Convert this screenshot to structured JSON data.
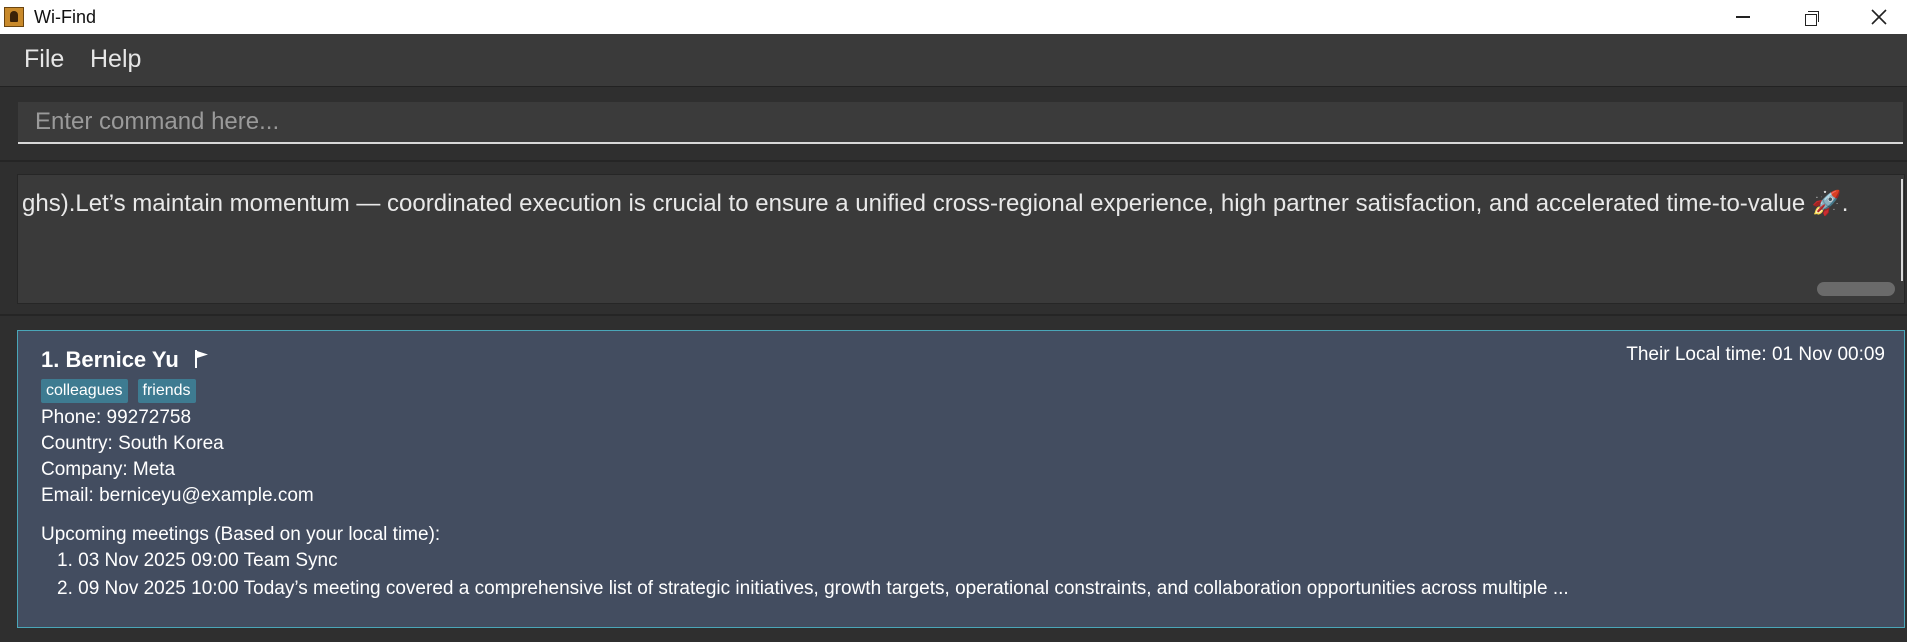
{
  "window": {
    "title": "Wi-Find"
  },
  "menu": {
    "items": [
      "File",
      "Help"
    ]
  },
  "command": {
    "placeholder": "Enter command here...",
    "value": ""
  },
  "result": {
    "text": "ghs).Let’s maintain momentum — coordinated execution is crucial to ensure a unified cross-regional experience, high partner satisfaction, and accelerated time-to-value 🚀."
  },
  "person": {
    "index_name": "1. Bernice Yu",
    "local_time": "Their Local time: 01 Nov 00:09",
    "tags": [
      "colleagues",
      "friends"
    ],
    "phone": "Phone: 99272758",
    "country": "Country: South Korea",
    "company": "Company: Meta",
    "email": "Email: berniceyu@example.com",
    "meetings_label": "Upcoming meetings (Based on your local time):",
    "meetings": [
      "1. 03 Nov 2025 09:00 Team Sync",
      "2. 09 Nov 2025 10:00 Today’s meeting covered a comprehensive list of strategic initiatives, growth targets, operational constraints, and collaboration opportunities across multiple ..."
    ]
  },
  "colors": {
    "card_bg": "#434d60",
    "card_border": "#4aa6b8",
    "tag_bg": "#3e7b91",
    "panel_bg": "#2f2f2f"
  }
}
